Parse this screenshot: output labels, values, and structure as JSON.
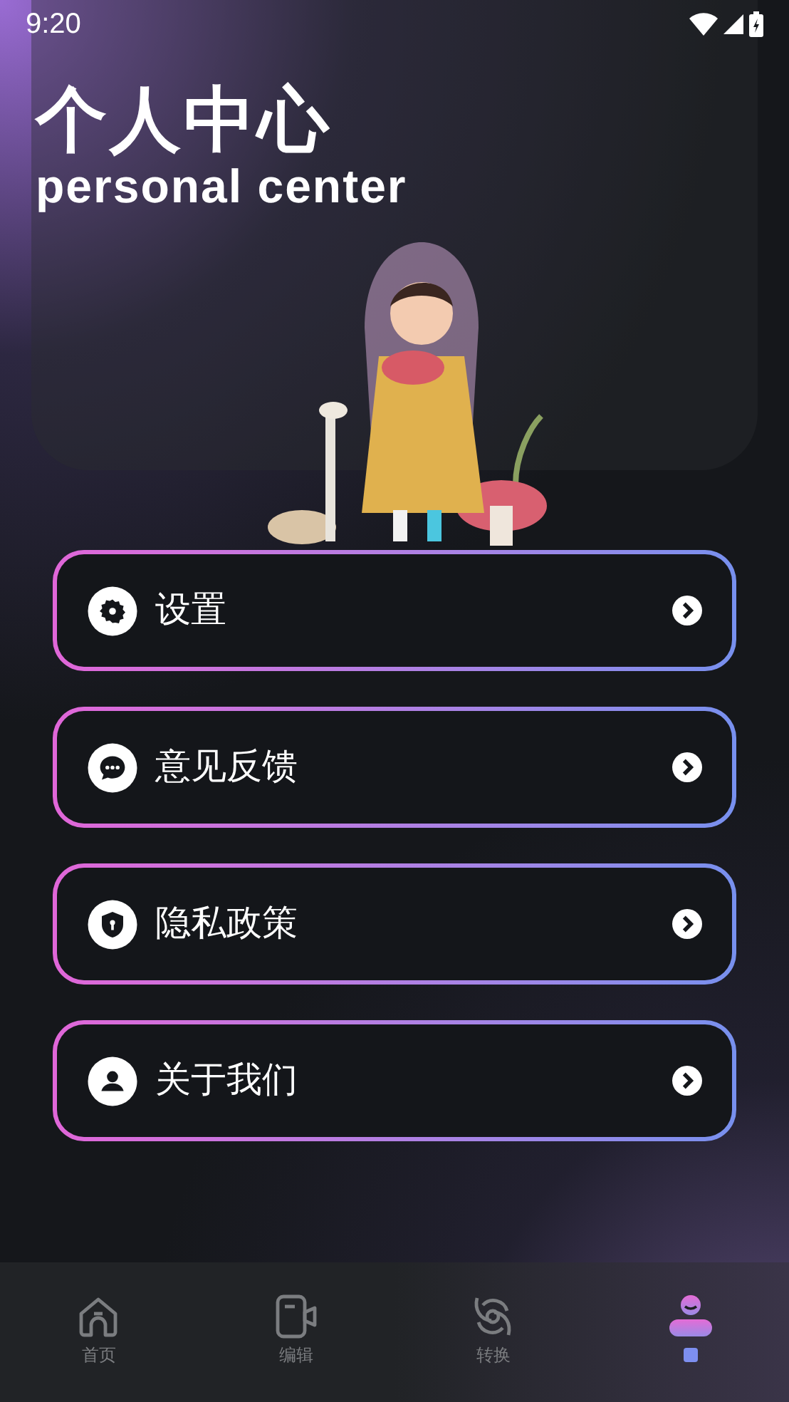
{
  "status_bar": {
    "time": "9:20"
  },
  "header": {
    "title": "个人中心",
    "subtitle": "personal center"
  },
  "menu": [
    {
      "kind": "settings",
      "label": "设置"
    },
    {
      "kind": "feedback",
      "label": "意见反馈"
    },
    {
      "kind": "privacy",
      "label": "隐私政策"
    },
    {
      "kind": "about",
      "label": "关于我们"
    }
  ],
  "bottom_nav": [
    {
      "kind": "home",
      "label": "首页",
      "selected": false
    },
    {
      "kind": "edit",
      "label": "编辑",
      "selected": false
    },
    {
      "kind": "convert",
      "label": "转换",
      "selected": false
    },
    {
      "kind": "profile",
      "selected": true
    }
  ]
}
